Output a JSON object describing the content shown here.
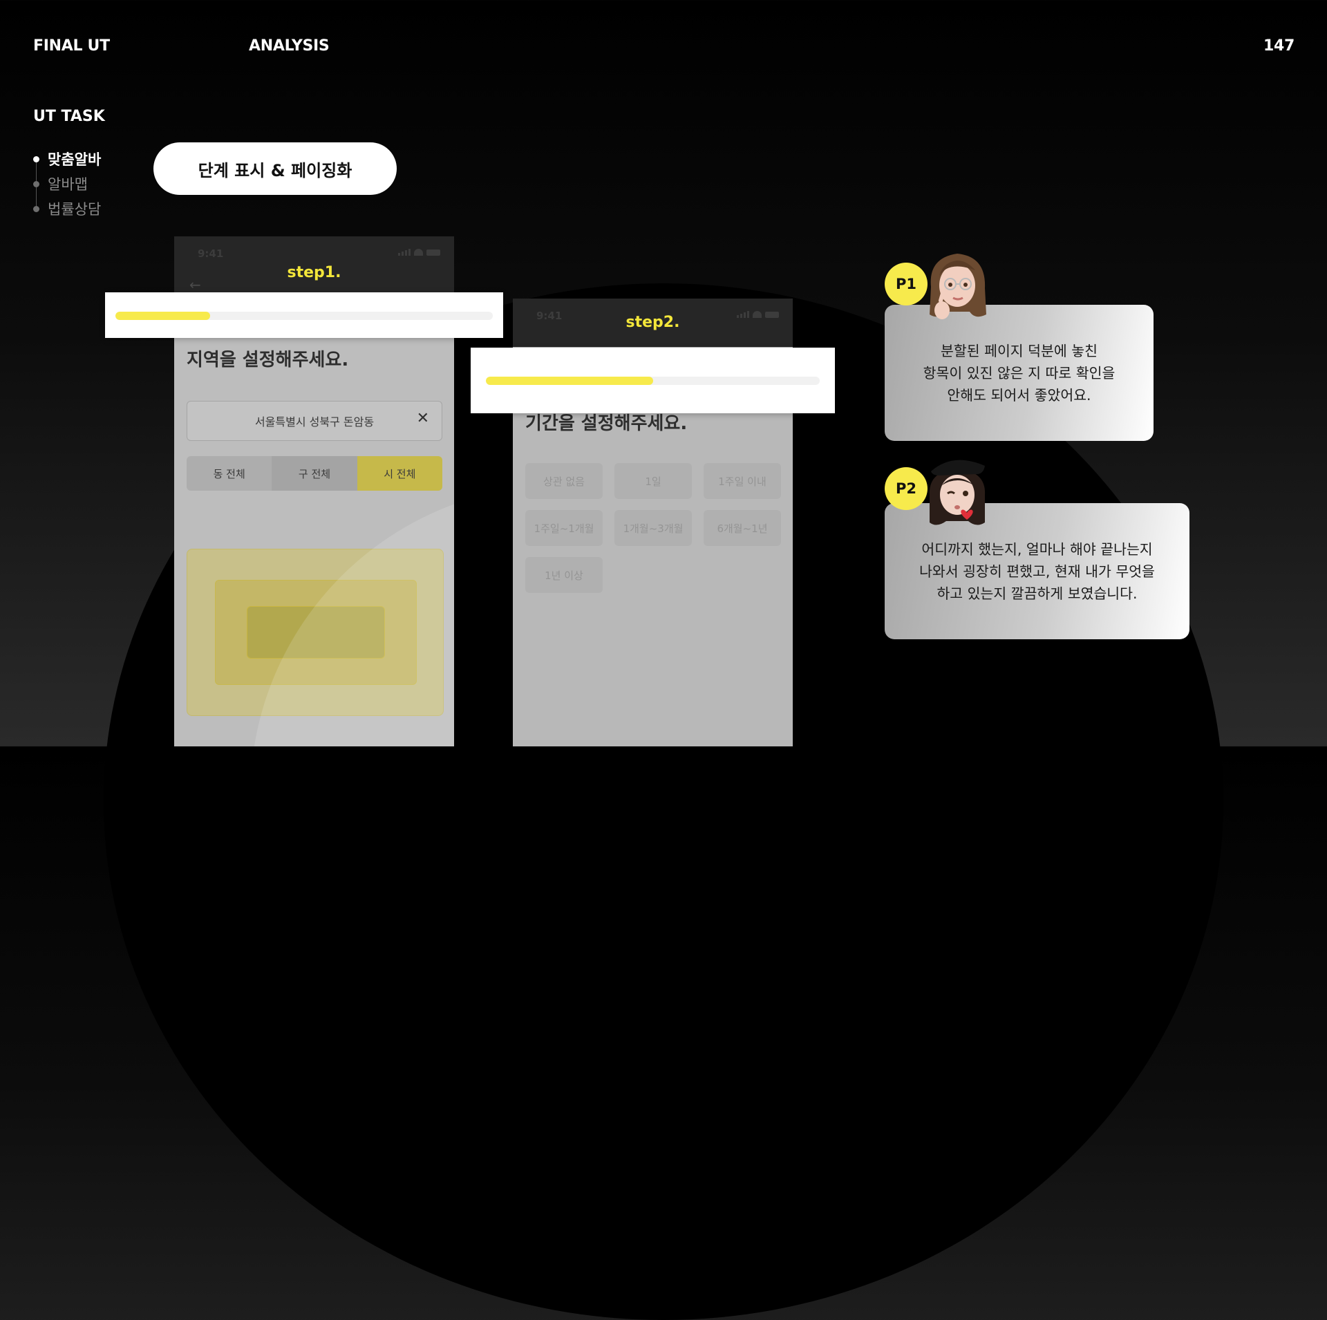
{
  "header": {
    "left": "FINAL UT",
    "section": "ANALYSIS",
    "page_number": "147"
  },
  "sidebar": {
    "title": "UT TASK",
    "items": [
      {
        "label": "맞춤알바",
        "active": true
      },
      {
        "label": "알바맵",
        "active": false
      },
      {
        "label": "법률상담",
        "active": false
      }
    ]
  },
  "feature_pill": "단계 표시 & 페이징화",
  "phone1": {
    "time": "9:41",
    "step": "step1.",
    "question": "지역을 설정해주세요.",
    "address": "서울특별시 성북구 돈암동",
    "clear_icon": "close-icon",
    "segments": [
      "동 전체",
      "구 전체",
      "시 전체"
    ],
    "selected_segment": "시 전체",
    "progress_pct": 25
  },
  "phone2": {
    "time": "9:41",
    "step": "step2.",
    "question": "기간을 설정해주세요.",
    "chips": [
      "상관 없음",
      "1일",
      "1주일 이내",
      "1주일~1개월",
      "1개월~3개월",
      "6개월~1년",
      "1년 이상"
    ],
    "progress_pct": 50
  },
  "participants": [
    {
      "badge": "P1",
      "avatar": "thinking-avatar-icon",
      "lines": [
        "분할된 페이지 덕분에 놓친",
        "항목이 있진 않은 지 따로 확인을",
        "안해도 되어서 좋았어요."
      ]
    },
    {
      "badge": "P2",
      "avatar": "winking-avatar-icon",
      "lines": [
        "어디까지 했는지, 얼마나 해야 끝나는지",
        "나와서 굉장히 편했고, 현재 내가 무엇을",
        "하고 있는지 깔끔하게 보였습니다."
      ]
    }
  ],
  "colors": {
    "accent": "#f7ea4c",
    "background": "#000000"
  }
}
